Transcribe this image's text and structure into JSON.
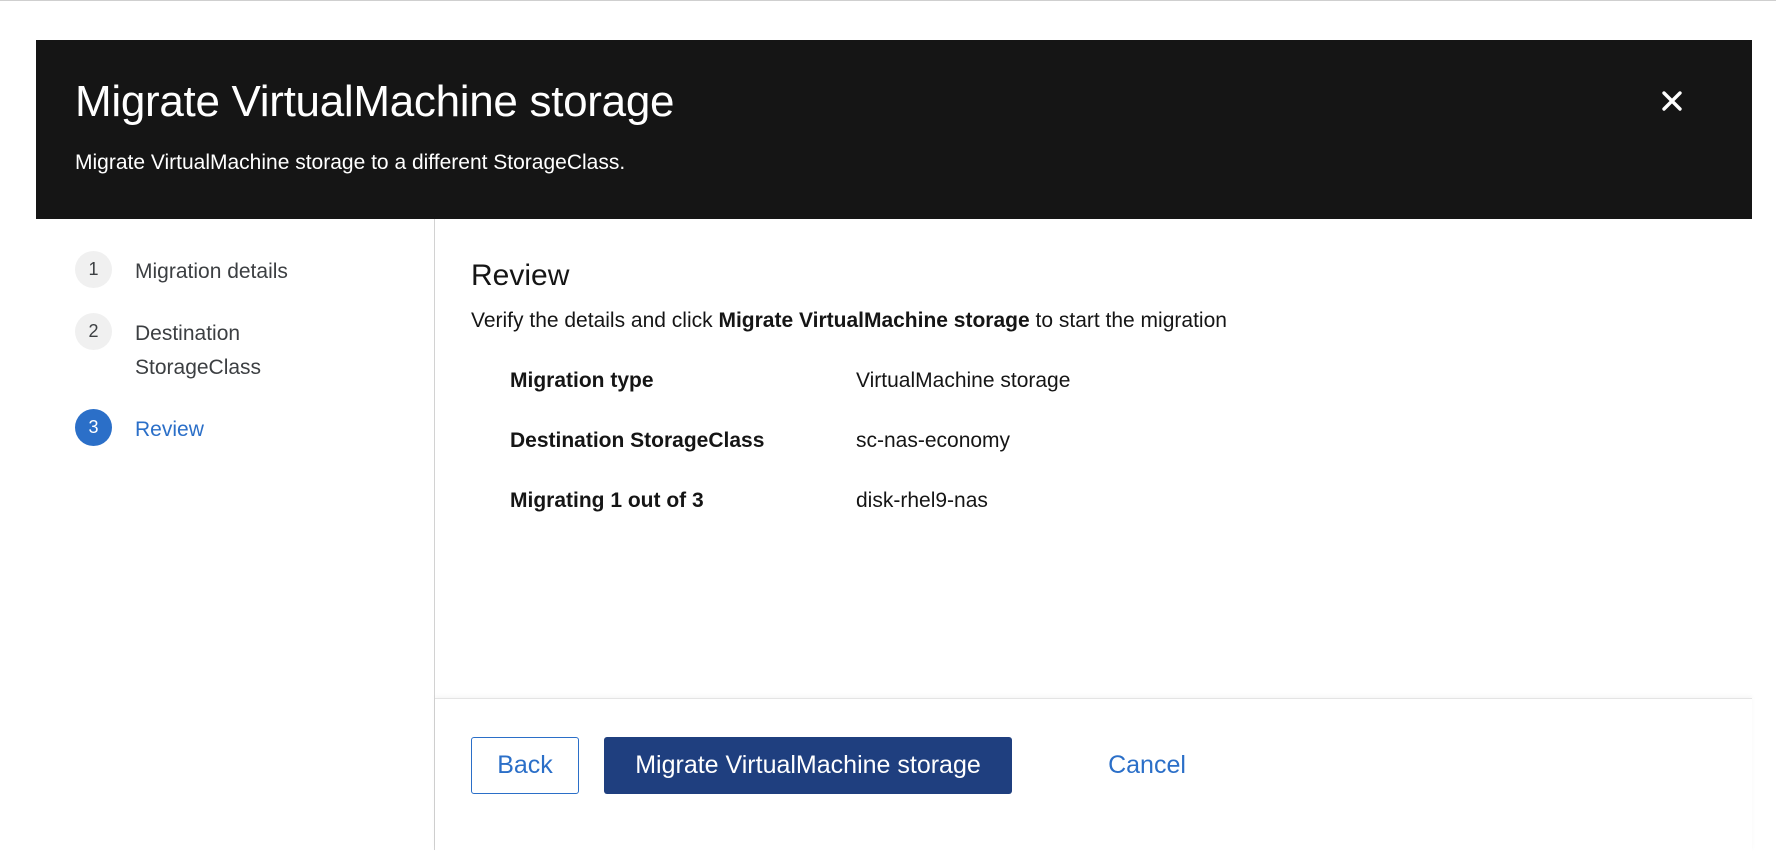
{
  "modal": {
    "title": "Migrate VirtualMachine storage",
    "subtitle": "Migrate VirtualMachine storage to a different StorageClass.",
    "close_icon": "close-icon"
  },
  "wizard_nav": {
    "steps": [
      {
        "number": "1",
        "label": "Migration details",
        "current": false
      },
      {
        "number": "2",
        "label": "Destination StorageClass",
        "current": false
      },
      {
        "number": "3",
        "label": "Review",
        "current": true
      }
    ]
  },
  "review": {
    "title": "Review",
    "description_prefix": "Verify the details and click ",
    "description_bold": "Migrate VirtualMachine storage",
    "description_suffix": " to start the migration",
    "items": [
      {
        "term": "Migration type",
        "value": "VirtualMachine storage"
      },
      {
        "term": "Destination StorageClass",
        "value": "sc-nas-economy"
      },
      {
        "term": "Migrating 1 out of 3",
        "value": "disk-rhel9-nas"
      }
    ]
  },
  "footer": {
    "back_label": "Back",
    "primary_label": "Migrate VirtualMachine storage",
    "cancel_label": "Cancel"
  },
  "colors": {
    "header_bg": "#151515",
    "accent": "#2b6fc8",
    "primary_button": "#1f3f7f"
  }
}
